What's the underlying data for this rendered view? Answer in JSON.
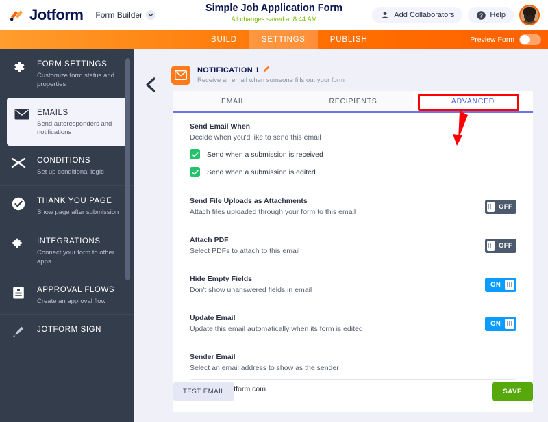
{
  "header": {
    "brand": "Jotform",
    "product_menu": "Form Builder",
    "form_title": "Simple Job Application Form",
    "saved_status": "All changes saved at 8:44 AM",
    "add_collaborators": "Add Collaborators",
    "help": "Help",
    "accent_orange": "#ff6100",
    "brand_navy": "#0a1551",
    "saved_green": "#78bb07"
  },
  "nav": {
    "items": [
      {
        "label": "BUILD",
        "active": false
      },
      {
        "label": "SETTINGS",
        "active": true
      },
      {
        "label": "PUBLISH",
        "active": false
      }
    ],
    "preview_label": "Preview Form",
    "preview_on": false
  },
  "sidebar": {
    "items": [
      {
        "label": "FORM SETTINGS",
        "desc": "Customize form status and properties",
        "icon": "gear-icon",
        "selected": false
      },
      {
        "label": "EMAILS",
        "desc": "Send autoresponders and notifications",
        "icon": "envelope-icon",
        "selected": true
      },
      {
        "label": "CONDITIONS",
        "desc": "Set up conditional logic",
        "icon": "shuffle-icon",
        "selected": false
      },
      {
        "label": "THANK YOU PAGE",
        "desc": "Show page after submission",
        "icon": "check-circle-icon",
        "selected": false
      },
      {
        "label": "INTEGRATIONS",
        "desc": "Connect your form to other apps",
        "icon": "puzzle-icon",
        "selected": false
      },
      {
        "label": "APPROVAL FLOWS",
        "desc": "Create an approval flow",
        "icon": "approval-flow-icon",
        "selected": false
      },
      {
        "label": "JOTFORM SIGN",
        "desc": "",
        "icon": "pen-icon",
        "selected": false
      }
    ],
    "background": "#343d4b"
  },
  "panel": {
    "notification_title": "NOTIFICATION 1",
    "notification_sub": "Receive an email when someone fills out your form",
    "tabs": [
      {
        "label": "EMAIL",
        "active": false
      },
      {
        "label": "RECIPIENTS",
        "active": false
      },
      {
        "label": "ADVANCED",
        "active": true
      }
    ],
    "send_when": {
      "title": "Send Email When",
      "desc": "Decide when you'd like to send this email",
      "options": [
        {
          "label": "Send when a submission is received",
          "checked": true
        },
        {
          "label": "Send when a submission is edited",
          "checked": true
        }
      ]
    },
    "settings": [
      {
        "title": "Send File Uploads as Attachments",
        "desc": "Attach files uploaded through your form to this email",
        "state": "OFF"
      },
      {
        "title": "Attach PDF",
        "desc": "Select PDFs to attach to this email",
        "state": "OFF"
      },
      {
        "title": "Hide Empty Fields",
        "desc": "Don't show unanswered fields in email",
        "state": "ON"
      },
      {
        "title": "Update Email",
        "desc": "Update this email automatically when its form is edited",
        "state": "ON"
      }
    ],
    "sender": {
      "title": "Sender Email",
      "desc": "Select an email address to show as the sender",
      "value": "noreply@jotform.com"
    },
    "test_email_label": "TEST EMAIL",
    "save_label": "SAVE",
    "toggle_on_color": "#0a9dff",
    "toggle_off_color": "#4d5a6d",
    "checkbox_color": "#24c26a",
    "save_color": "#57a80b",
    "tab_active_color": "#4b5ce6"
  },
  "annotation": {
    "highlight_color": "#ff0000",
    "highlight_target": "ADVANCED"
  }
}
